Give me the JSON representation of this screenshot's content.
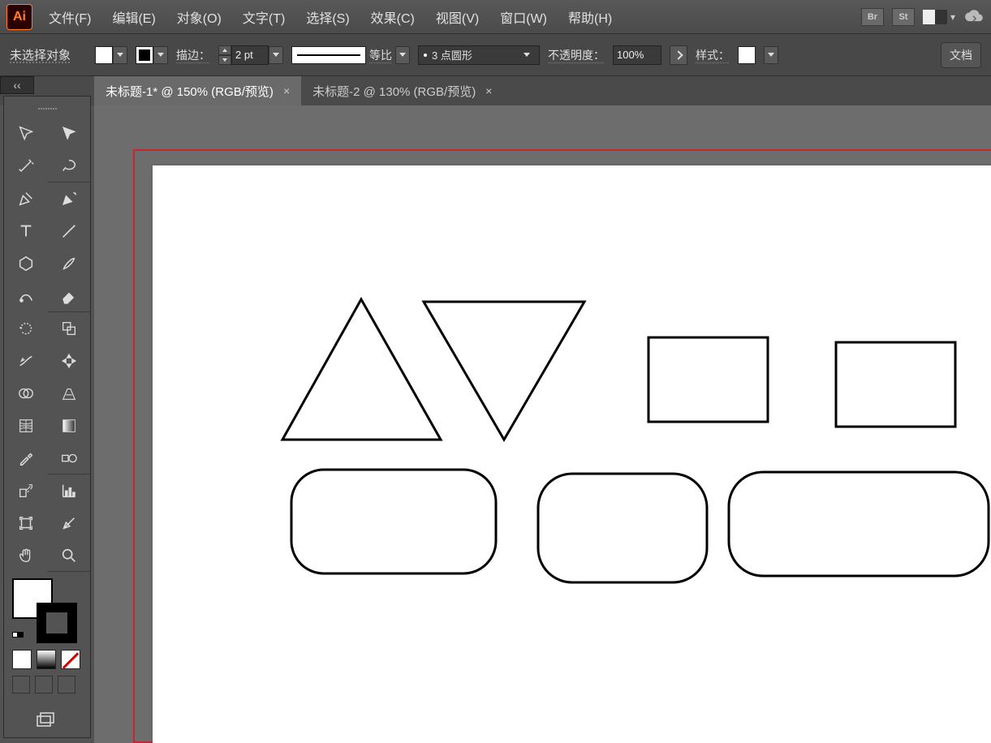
{
  "menubar": {
    "logo": "Ai",
    "items": [
      "文件(F)",
      "编辑(E)",
      "对象(O)",
      "文字(T)",
      "选择(S)",
      "效果(C)",
      "视图(V)",
      "窗口(W)",
      "帮助(H)"
    ],
    "bridge": "Br",
    "stock": "St"
  },
  "controlbar": {
    "status": "未选择对象",
    "stroke_label": "描边：",
    "stroke_weight": "2 pt",
    "dash_label": "等比",
    "brush_value": "3 点圆形",
    "opacity_label": "不透明度：",
    "opacity_value": "100%",
    "style_label": "样式：",
    "docsetup": "文档"
  },
  "tabs": [
    {
      "label": "未标题-1* @ 150% (RGB/预览)",
      "active": true
    },
    {
      "label": "未标题-2 @ 130% (RGB/预览)",
      "active": false
    }
  ],
  "toolbox_collapse": "‹‹",
  "tools": [
    [
      "selection-tool",
      "direct-selection-tool"
    ],
    [
      "magic-wand-tool",
      "lasso-tool"
    ],
    [
      "pen-tool",
      "curvature-tool"
    ],
    [
      "type-tool",
      "line-tool"
    ],
    [
      "shape-tool",
      "paintbrush-tool"
    ],
    [
      "shaper-tool",
      "eraser-tool"
    ],
    [
      "rotate-tool",
      "scale-tool"
    ],
    [
      "width-tool",
      "free-transform-tool"
    ],
    [
      "shape-builder-tool",
      "perspective-tool"
    ],
    [
      "mesh-tool",
      "gradient-tool"
    ],
    [
      "eyedropper-tool",
      "blend-tool"
    ],
    [
      "symbol-sprayer-tool",
      "graph-tool"
    ],
    [
      "artboard-tool",
      "slice-tool"
    ],
    [
      "hand-tool",
      "zoom-tool"
    ]
  ]
}
